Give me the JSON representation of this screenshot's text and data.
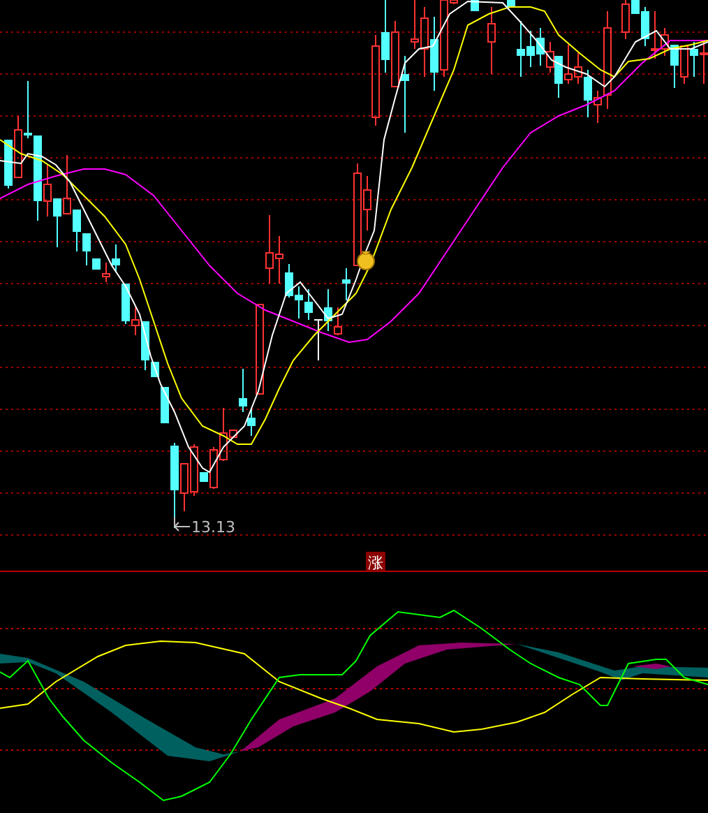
{
  "price_panel": {
    "low_price_label": "13.13"
  },
  "indicator_panel": {
    "badge": "涨"
  }
}
